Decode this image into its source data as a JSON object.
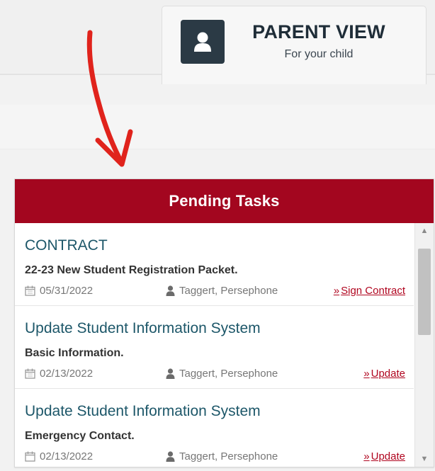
{
  "parent_tab": {
    "title": "PARENT VIEW",
    "subtitle": "For your child",
    "icon": "user-icon"
  },
  "annotation": {
    "arrow_color": "#e0231c"
  },
  "panel": {
    "title": "Pending Tasks",
    "header_color": "#a3061f",
    "tasks": [
      {
        "title": "CONTRACT",
        "description": "22-23 New Student Registration Packet.",
        "date": "05/31/2022",
        "person": "Taggert, Persephone",
        "action": "Sign Contract"
      },
      {
        "title": "Update Student Information System",
        "description": "Basic Information.",
        "date": "02/13/2022",
        "person": "Taggert, Persephone",
        "action": "Update"
      },
      {
        "title": "Update Student Information System",
        "description": "Emergency Contact.",
        "date": "02/13/2022",
        "person": "Taggert, Persephone",
        "action": "Update"
      }
    ]
  }
}
